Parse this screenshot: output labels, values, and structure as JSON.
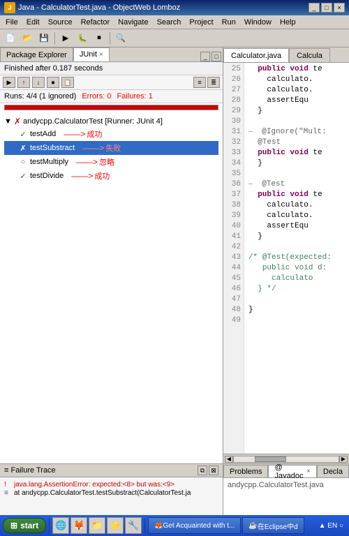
{
  "window": {
    "title": "Java - CalculatorTest.java - ObjectWeb Lomboz"
  },
  "menubar": {
    "items": [
      "File",
      "Edit",
      "Source",
      "Refactor",
      "Navigate",
      "Search",
      "Project",
      "Run",
      "Window",
      "Help"
    ]
  },
  "left_tabs": {
    "tab1": "Package Explorer",
    "tab2": "JUnit",
    "close": "×"
  },
  "junit": {
    "header": "Finished after 0.187 seconds",
    "stats": {
      "runs": "Runs: 4/4 (1 ignored)",
      "errors_label": "Errors:",
      "errors_value": "0",
      "failures_label": "Failures:",
      "failures_value": "1"
    },
    "suite": "andycpp.CalculatorTest [Runner: JUnit 4]",
    "tests": [
      {
        "name": "testAdd",
        "status": "pass",
        "label": "成功"
      },
      {
        "name": "testSubstract",
        "status": "fail",
        "label": "失败",
        "selected": true
      },
      {
        "name": "testMultiply",
        "status": "ignore",
        "label": "忽略"
      },
      {
        "name": "testDivide",
        "status": "pass",
        "label": "成功"
      }
    ]
  },
  "failure_trace": {
    "header": "Failure Trace",
    "line1": "java.lang.AssertionError: expected:<8> but was:<9>",
    "line2": "at andycpp.CalculatorTest.testSubstract(CalculatorTest.ja"
  },
  "editor": {
    "tabs": [
      "Calculator.java",
      "Calcula"
    ],
    "lines": [
      {
        "num": "25",
        "code": "  public void te",
        "indent": 4
      },
      {
        "num": "26",
        "code": "    calculato.",
        "indent": 8
      },
      {
        "num": "27",
        "code": "    calculato.",
        "indent": 8
      },
      {
        "num": "28",
        "code": "    assertEquals",
        "indent": 8
      },
      {
        "num": "29",
        "code": "  }",
        "indent": 4
      },
      {
        "num": "30",
        "code": "",
        "indent": 0
      },
      {
        "num": "31",
        "code": "  @Ignore(\"Mult:",
        "indent": 4,
        "type": "annotation",
        "collapse": true
      },
      {
        "num": "32",
        "code": "  @Test",
        "indent": 4,
        "type": "annotation"
      },
      {
        "num": "33",
        "code": "  public void te",
        "indent": 4
      },
      {
        "num": "34",
        "code": "  }",
        "indent": 4
      },
      {
        "num": "35",
        "code": "",
        "indent": 0
      },
      {
        "num": "36",
        "code": "  @Test",
        "indent": 4,
        "collapse": true
      },
      {
        "num": "37",
        "code": "  public void te",
        "indent": 4
      },
      {
        "num": "38",
        "code": "    calculato.",
        "indent": 8
      },
      {
        "num": "39",
        "code": "    calculato.",
        "indent": 8
      },
      {
        "num": "40",
        "code": "    assertEquals",
        "indent": 8
      },
      {
        "num": "41",
        "code": "  }",
        "indent": 4
      },
      {
        "num": "42",
        "code": "",
        "indent": 0
      },
      {
        "num": "43",
        "code": "/* @Test(expected:",
        "indent": 0,
        "type": "comment"
      },
      {
        "num": "44",
        "code": "   public void d:",
        "indent": 3,
        "type": "comment"
      },
      {
        "num": "45",
        "code": "     calculato",
        "indent": 5,
        "type": "comment"
      },
      {
        "num": "46",
        "code": "  } */",
        "indent": 2,
        "type": "comment"
      },
      {
        "num": "47",
        "code": "",
        "indent": 0
      },
      {
        "num": "48",
        "code": "}",
        "indent": 0
      },
      {
        "num": "49",
        "code": "",
        "indent": 0
      }
    ]
  },
  "bottom_panel": {
    "tabs": [
      "Problems",
      "@ Javadoc",
      "Decla"
    ],
    "active": "Javadoc",
    "content": "andycpp.CalculatorTest.java"
  },
  "taskbar": {
    "start_label": "start",
    "windows": [
      "Get Acquainted with t...",
      "在Eclipse中d"
    ],
    "time": "▲ EN ○"
  }
}
